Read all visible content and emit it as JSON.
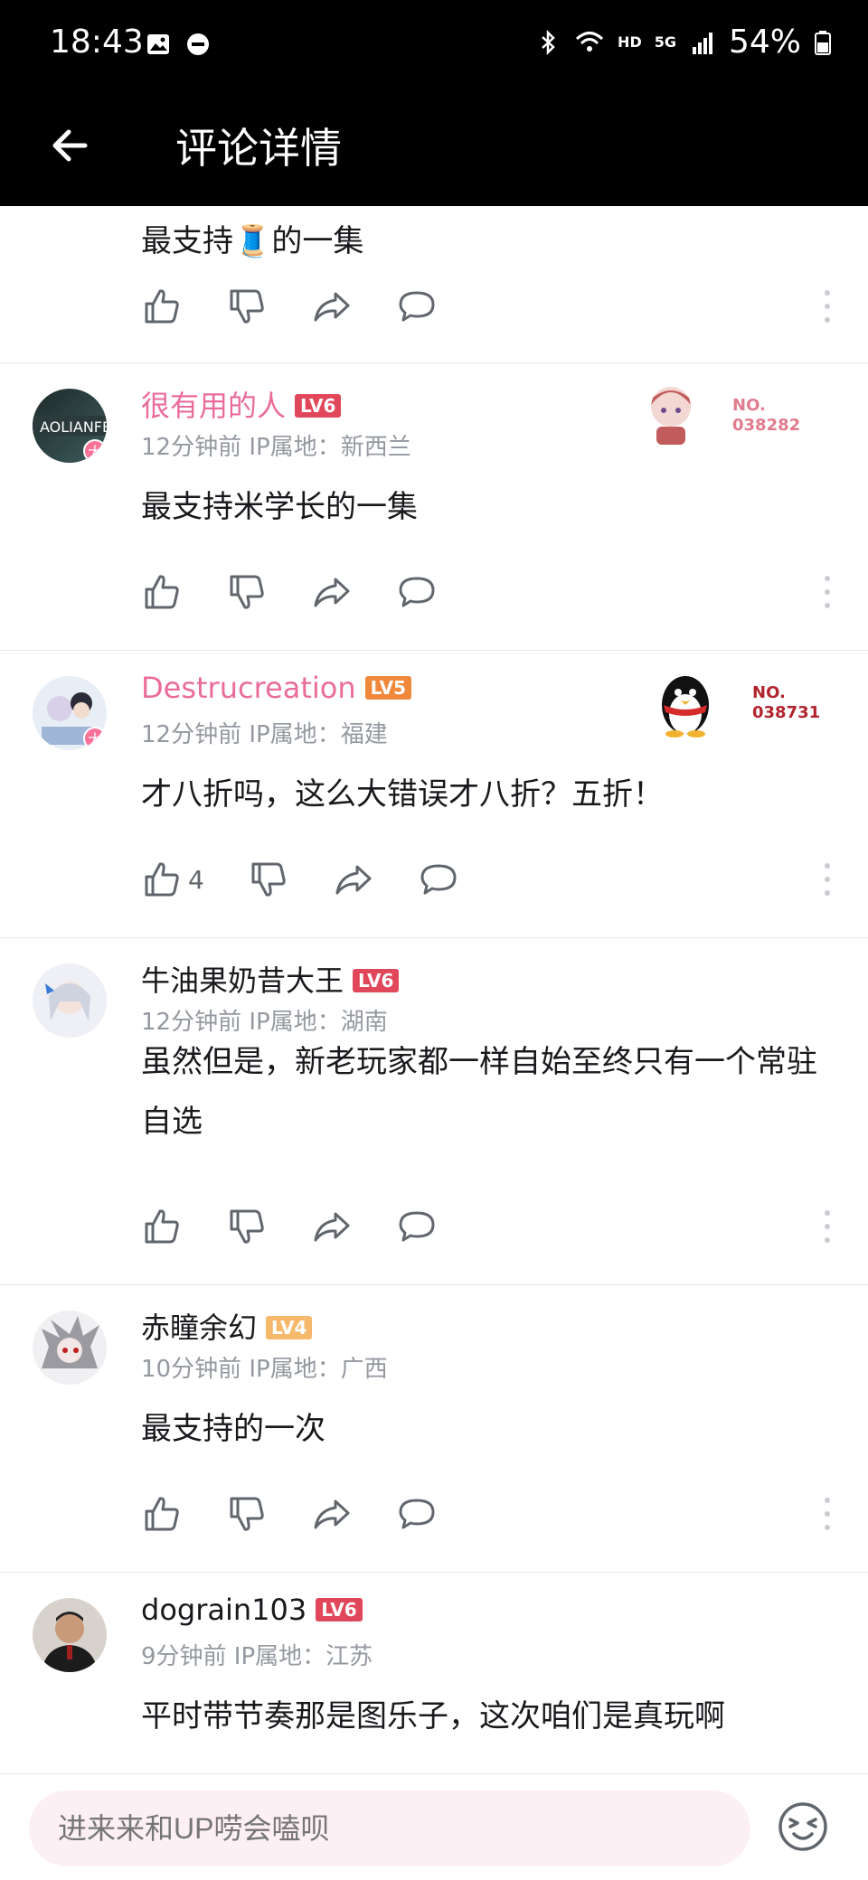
{
  "status_bar": {
    "time": "18:43",
    "network": "HD",
    "network_gen": "5G",
    "battery": "54%"
  },
  "header": {
    "title": "评论详情"
  },
  "comments": [
    {
      "text": "最支持🧵的一集"
    },
    {
      "username": "很有用的人",
      "level": "LV6",
      "meta": "12分钟前 IP属地：新西兰",
      "text": "最支持米学长的一集",
      "avatar_badge": "大",
      "deco_no": "NO.",
      "deco_num": "038282"
    },
    {
      "username": "Destrucreation",
      "level": "LV5",
      "meta": "12分钟前 IP属地：福建",
      "text": "才八折吗，这么大错误才八折？五折！",
      "likes": "4",
      "avatar_badge": "大",
      "deco_no": "NO.",
      "deco_num": "038731"
    },
    {
      "username": "牛油果奶昔大王",
      "level": "LV6",
      "meta": "12分钟前 IP属地：湖南",
      "text": "虽然但是，新老玩家都一样自始至终只有一个常驻自选"
    },
    {
      "username": "赤瞳余幻",
      "level": "LV4",
      "meta": "10分钟前 IP属地：广西",
      "text": "最支持的一次"
    },
    {
      "username": "dograin103",
      "level": "LV6",
      "meta": "9分钟前 IP属地：江苏",
      "text": "平时带节奏那是图乐子，这次咱们是真玩啊"
    }
  ],
  "input": {
    "placeholder": "进来来和UP唠会嗑呗"
  },
  "colors": {
    "accent_pink": "#fb7299",
    "vip_name": "#e96c9b",
    "lv6": "#e1475a",
    "lv5": "#f0883b",
    "lv4": "#f6b96b",
    "meta_gray": "#9499a0"
  },
  "icons": [
    "back-arrow-icon",
    "like-icon",
    "dislike-icon",
    "share-icon",
    "reply-icon",
    "more-icon",
    "emoji-icon"
  ]
}
